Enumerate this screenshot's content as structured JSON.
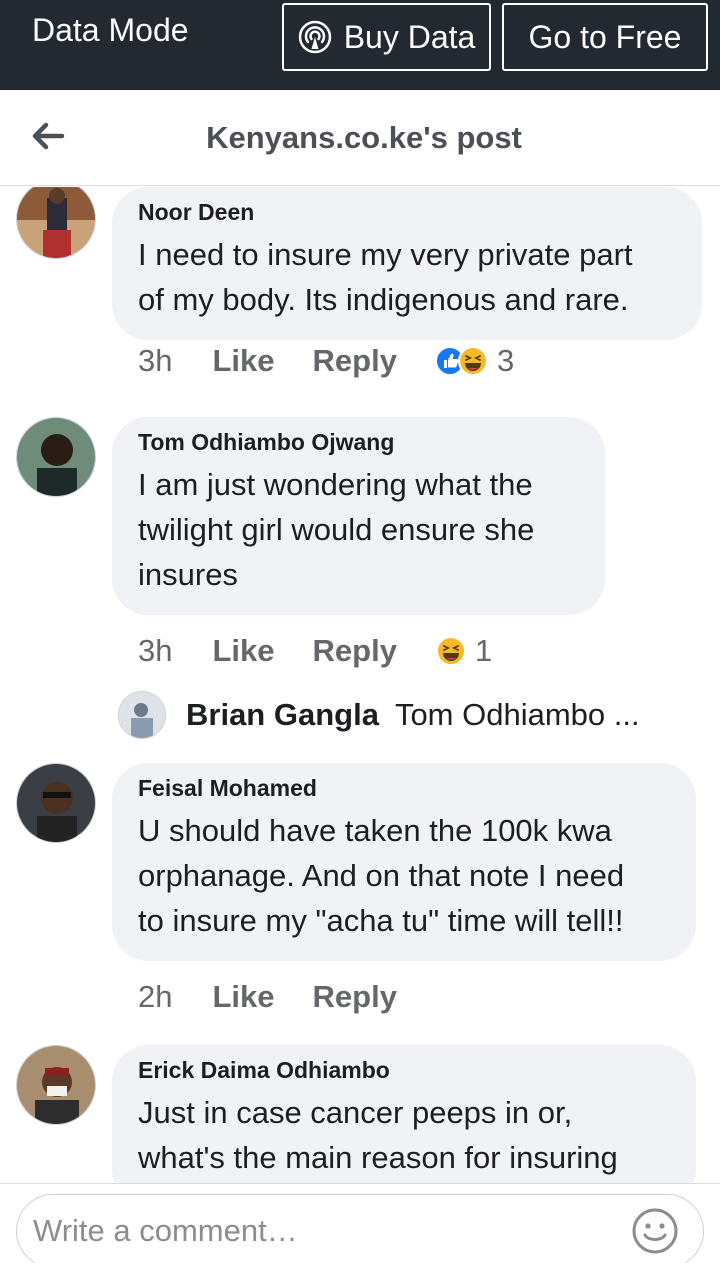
{
  "databar": {
    "mode_label": "Data Mode",
    "buy_label": "Buy Data",
    "free_label": "Go to Free"
  },
  "header": {
    "title": "Kenyans.co.ke's post"
  },
  "comments": [
    {
      "name": "Noor Deen",
      "text": "I need to insure my very private part\nof my body. Its indigenous and rare.",
      "time": "3h",
      "like": "Like",
      "reply": "Reply",
      "reactions": [
        "like",
        "haha"
      ],
      "reaction_count": "3"
    },
    {
      "name": "Tom Odhiambo Ojwang",
      "text": "I am just wondering what the\ntwilight girl would ensure she\ninsures",
      "time": "3h",
      "like": "Like",
      "reply": "Reply",
      "reactions": [
        "haha"
      ],
      "reaction_count": "1",
      "reply_preview": {
        "name": "Brian Gangla",
        "text": "Tom Odhiambo ..."
      }
    },
    {
      "name": "Feisal Mohamed",
      "text": "U should have taken the 100k kwa\norphanage. And on that note I need\nto insure my \"acha tu\" time will tell!!",
      "time": "2h",
      "like": "Like",
      "reply": "Reply"
    },
    {
      "name": "Erick Daima Odhiambo",
      "text": "Just in case cancer peeps in or,\nwhat's the main reason for insuring"
    }
  ],
  "composer": {
    "placeholder": "Write a comment…"
  },
  "icons": {
    "back": "back-arrow-icon",
    "buy": "broadcast-icon",
    "emoji": "emoji-icon"
  },
  "colors": {
    "databar_bg": "#232931",
    "bubble_bg": "#f0f2f5",
    "like_blue": "#1877f2",
    "haha_yellow": "#f7b928"
  }
}
